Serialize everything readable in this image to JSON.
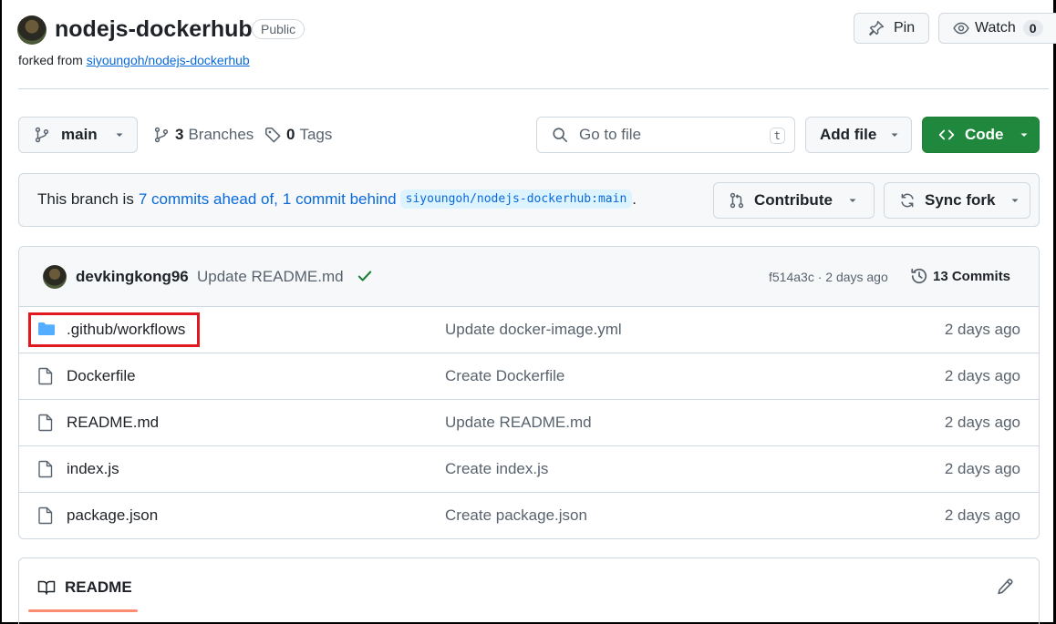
{
  "repo": {
    "name": "nodejs-dockerhub",
    "visibility": "Public",
    "forked_prefix": "forked from",
    "forked_from": "siyoungoh/nodejs-dockerhub"
  },
  "header_actions": {
    "pin_label": "Pin",
    "watch_label": "Watch",
    "watch_count": "0"
  },
  "toolbar": {
    "branch": "main",
    "branches_count": "3",
    "branches_label": "Branches",
    "tags_count": "0",
    "tags_label": "Tags",
    "search_placeholder": "Go to file",
    "search_shortcut": "t",
    "add_file_label": "Add file",
    "code_label": "Code"
  },
  "fork_status": {
    "prefix": "This branch is",
    "ahead": "7 commits ahead of,",
    "behind": "1 commit behind",
    "upstream": "siyoungoh/nodejs-dockerhub:main",
    "suffix": ".",
    "contribute_label": "Contribute",
    "sync_label": "Sync fork"
  },
  "latest_commit": {
    "author": "devkingkong96",
    "message": "Update README.md",
    "sha_and_time": "f514a3c · 2 days ago",
    "commits_count_label": "13 Commits"
  },
  "files": [
    {
      "name": ".github/workflows",
      "type": "folder",
      "message": "Update docker-image.yml",
      "age": "2 days ago"
    },
    {
      "name": "Dockerfile",
      "type": "file",
      "message": "Create Dockerfile",
      "age": "2 days ago"
    },
    {
      "name": "README.md",
      "type": "file",
      "message": "Update README.md",
      "age": "2 days ago"
    },
    {
      "name": "index.js",
      "type": "file",
      "message": "Create index.js",
      "age": "2 days ago"
    },
    {
      "name": "package.json",
      "type": "file",
      "message": "Create package.json",
      "age": "2 days ago"
    }
  ],
  "readme": {
    "tab_label": "README"
  },
  "colors": {
    "accent": "#0969da",
    "code_button": "#1f883d",
    "folder": "#54aeff",
    "success": "#1a7f37",
    "highlight": "#e0191e",
    "readme_underline": "#fd8c73"
  }
}
